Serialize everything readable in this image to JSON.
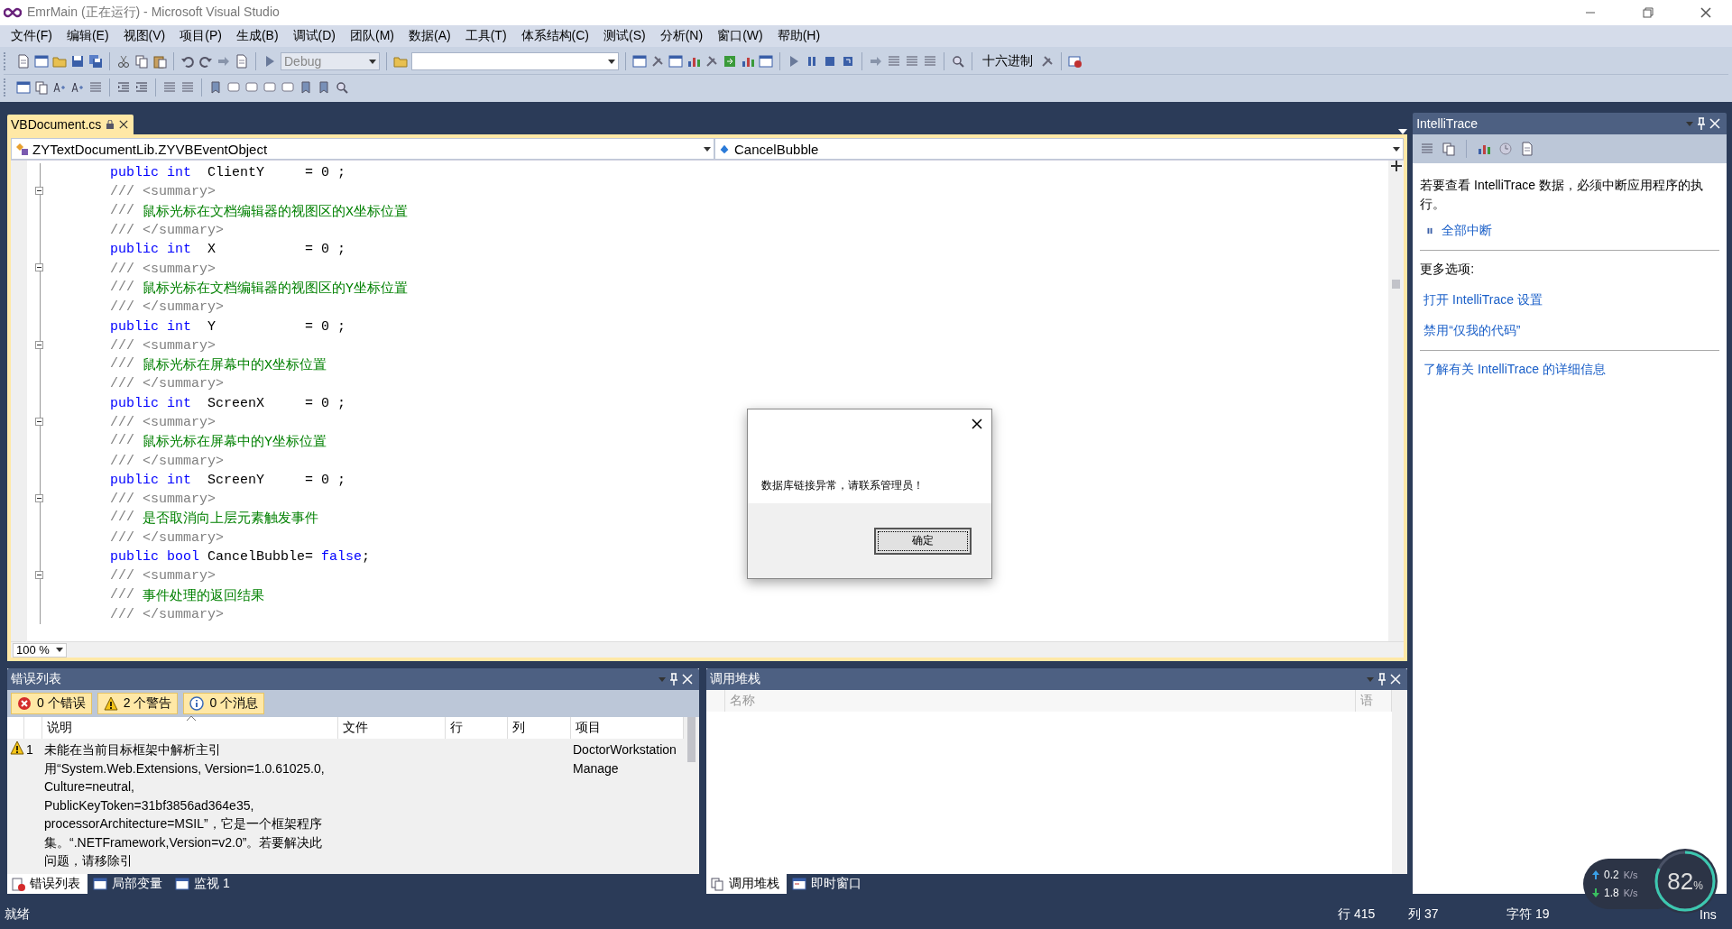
{
  "window": {
    "title": "EmrMain (正在运行) - Microsoft Visual Studio"
  },
  "menu": [
    "文件(F)",
    "编辑(E)",
    "视图(V)",
    "项目(P)",
    "生成(B)",
    "调试(D)",
    "团队(M)",
    "数据(A)",
    "工具(T)",
    "体系结构(C)",
    "测试(S)",
    "分析(N)",
    "窗口(W)",
    "帮助(H)"
  ],
  "toolbar": {
    "configuration": {
      "value": "Debug",
      "disabled": true
    },
    "hex_button": "十六进制"
  },
  "editor": {
    "tabs": [
      {
        "label": "VBDocument.cs",
        "selected": true
      }
    ],
    "type_dropdown": "ZYTextDocumentLib.ZYVBEventObject",
    "member_dropdown": "CancelBubble",
    "lines": [
      {
        "kind": "code",
        "fold": false,
        "tokens": [
          {
            "kind": "keyword",
            "text": "public int"
          },
          {
            "kind": "plain",
            "text": "  ClientY     = 0 ;"
          }
        ]
      },
      {
        "kind": "doc-tag",
        "fold": true,
        "text": "/// <summary>"
      },
      {
        "kind": "doc-text",
        "fold": false,
        "prefix": "///",
        "text": "鼠标光标在文档编辑器的视图区的X坐标位置"
      },
      {
        "kind": "doc-tag",
        "fold": false,
        "text": "/// </summary>"
      },
      {
        "kind": "code",
        "fold": false,
        "tokens": [
          {
            "kind": "keyword",
            "text": "public int"
          },
          {
            "kind": "plain",
            "text": "  X           = 0 ;"
          }
        ]
      },
      {
        "kind": "doc-tag",
        "fold": true,
        "text": "/// <summary>"
      },
      {
        "kind": "doc-text",
        "fold": false,
        "prefix": "///",
        "text": "鼠标光标在文档编辑器的视图区的Y坐标位置"
      },
      {
        "kind": "doc-tag",
        "fold": false,
        "text": "/// </summary>"
      },
      {
        "kind": "code",
        "fold": false,
        "tokens": [
          {
            "kind": "keyword",
            "text": "public int"
          },
          {
            "kind": "plain",
            "text": "  Y           = 0 ;"
          }
        ]
      },
      {
        "kind": "doc-tag",
        "fold": true,
        "text": "/// <summary>"
      },
      {
        "kind": "doc-text",
        "fold": false,
        "prefix": "///",
        "text": "鼠标光标在屏幕中的X坐标位置"
      },
      {
        "kind": "doc-tag",
        "fold": false,
        "text": "/// </summary>"
      },
      {
        "kind": "code",
        "fold": false,
        "tokens": [
          {
            "kind": "keyword",
            "text": "public int"
          },
          {
            "kind": "plain",
            "text": "  ScreenX     = 0 ;"
          }
        ]
      },
      {
        "kind": "doc-tag",
        "fold": true,
        "text": "/// <summary>"
      },
      {
        "kind": "doc-text",
        "fold": false,
        "prefix": "///",
        "text": "鼠标光标在屏幕中的Y坐标位置"
      },
      {
        "kind": "doc-tag",
        "fold": false,
        "text": "/// </summary>"
      },
      {
        "kind": "code",
        "fold": false,
        "tokens": [
          {
            "kind": "keyword",
            "text": "public int"
          },
          {
            "kind": "plain",
            "text": "  ScreenY     = 0 ;"
          }
        ]
      },
      {
        "kind": "doc-tag",
        "fold": true,
        "text": "/// <summary>"
      },
      {
        "kind": "doc-text",
        "fold": false,
        "prefix": "///",
        "text": "是否取消向上层元素触发事件"
      },
      {
        "kind": "doc-tag",
        "fold": false,
        "text": "/// </summary>"
      },
      {
        "kind": "code",
        "fold": false,
        "tokens": [
          {
            "kind": "keyword",
            "text": "public bool"
          },
          {
            "kind": "plain",
            "text": " CancelBubble= "
          },
          {
            "kind": "keyword",
            "text": "false"
          },
          {
            "kind": "plain",
            "text": ";"
          }
        ]
      },
      {
        "kind": "doc-tag",
        "fold": true,
        "text": "/// <summary>"
      },
      {
        "kind": "doc-text",
        "fold": false,
        "prefix": "///",
        "text": "事件处理的返回结果"
      },
      {
        "kind": "doc-tag",
        "fold": false,
        "text": "/// </summary>"
      }
    ],
    "zoom": "100 %"
  },
  "error_list": {
    "title": "错误列表",
    "filters": [
      {
        "kind": "error",
        "label": "0 个错误",
        "on": true
      },
      {
        "kind": "warning",
        "label": "2 个警告",
        "on": true
      },
      {
        "kind": "info",
        "label": "0 个消息",
        "on": true
      }
    ],
    "columns": [
      "说明",
      "文件",
      "行",
      "列",
      "项目"
    ],
    "rows": [
      {
        "kind": "warning",
        "selected": true,
        "number": "1",
        "description": "未能在当前目标框架中解析主引用“System.Web.Extensions, Version=1.0.61025.0, Culture=neutral, PublicKeyToken=31bf3856ad364e35, processorArchitecture=MSIL”，它是一个框架程序集。“.NETFramework,Version=v2.0”。若要解决此问题，请移除引",
        "project": "DoctorWorkstationManage"
      }
    ]
  },
  "bottom_left_tabs": [
    {
      "label": "错误列表",
      "kind": "errors",
      "selected": true
    },
    {
      "label": "局部变量",
      "kind": "locals",
      "selected": false
    },
    {
      "label": "监视 1",
      "kind": "watch",
      "selected": false
    }
  ],
  "call_stack": {
    "title": "调用堆栈",
    "columns": [
      "名称",
      "语"
    ]
  },
  "bottom_right_tabs": [
    {
      "label": "调用堆栈",
      "kind": "stack",
      "selected": true
    },
    {
      "label": "即时窗口",
      "kind": "immediate",
      "selected": false
    }
  ],
  "intellitrace": {
    "title": "IntelliTrace",
    "message": "若要查看 IntelliTrace 数据，必须中断应用程序的执行。",
    "break_all": "全部中断",
    "more_options": "更多选项:",
    "links": [
      "打开 IntelliTrace 设置",
      "禁用“仅我的代码”"
    ],
    "learn_more": "了解有关 IntelliTrace 的详细信息"
  },
  "dialog": {
    "message": "数据库链接异常，请联系管理员！",
    "ok_button": "确定"
  },
  "status_bar": {
    "state": "就绪",
    "line": "行 415",
    "column": "列 37",
    "char": "字符 19",
    "mode": "Ins"
  },
  "network_widget": {
    "upload": "0.2",
    "download": "1.8",
    "upload_unit": "K/s",
    "download_unit": "K/s",
    "percent": "82",
    "percent_sign": "%"
  }
}
